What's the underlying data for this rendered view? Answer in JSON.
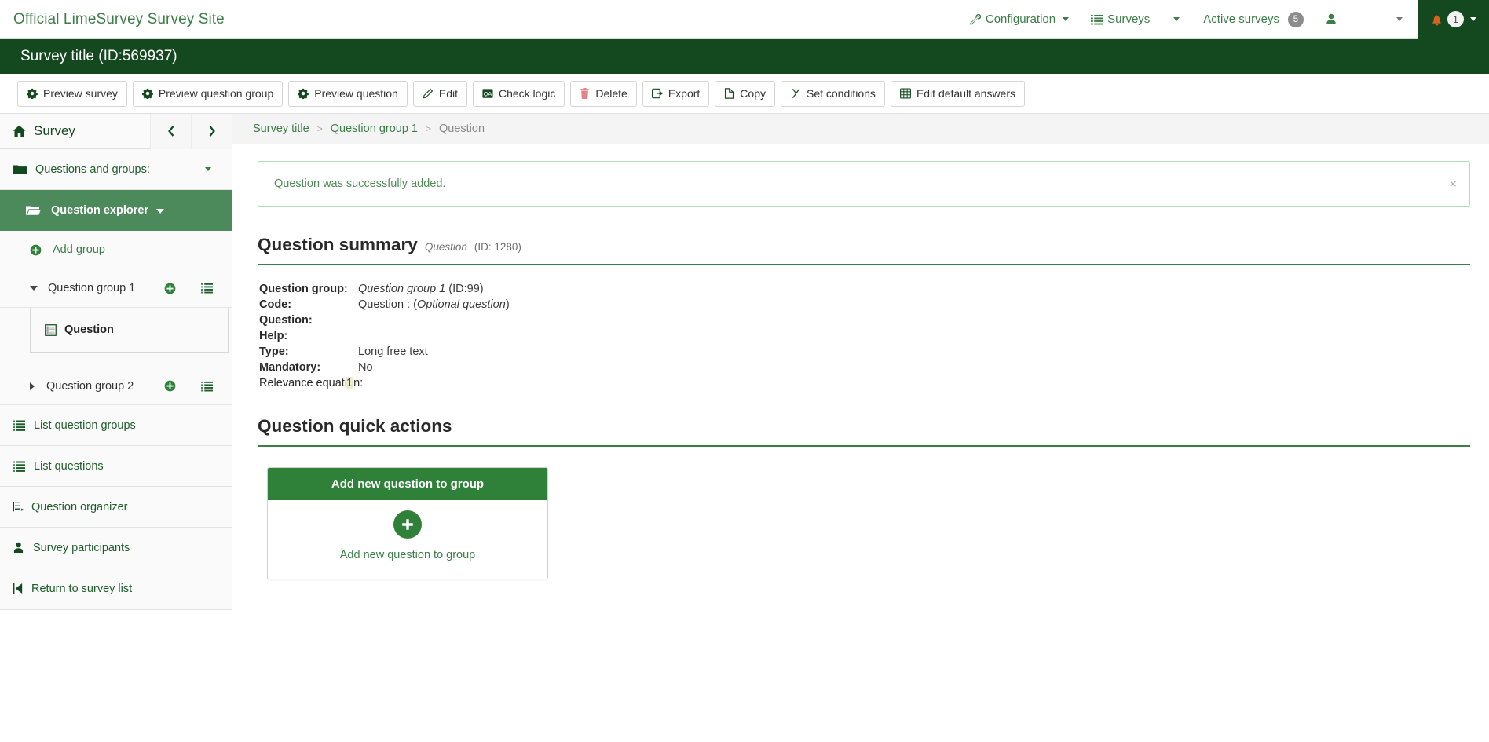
{
  "topbar": {
    "brand": "Official LimeSurvey Survey Site",
    "nav": [
      {
        "label": "Configuration",
        "icon": "wrench-icon",
        "caret": true
      },
      {
        "label": "Surveys",
        "icon": "list-icon",
        "caret": true
      },
      {
        "label": "Active surveys",
        "icon": "",
        "badge": "5"
      }
    ],
    "user_icon": "user-icon",
    "user_caret": true,
    "notifications": {
      "icon": "bell-icon",
      "count": "1"
    }
  },
  "survey_header": {
    "title": "Survey title (ID:569937)"
  },
  "toolbar": {
    "buttons": [
      {
        "label": "Preview survey",
        "icon": "gear-icon"
      },
      {
        "label": "Preview question group",
        "icon": "gear-icon"
      },
      {
        "label": "Preview question",
        "icon": "gear-icon"
      },
      {
        "label": "Edit",
        "icon": "pencil-icon"
      },
      {
        "label": "Check logic",
        "icon": "logic-icon"
      },
      {
        "label": "Delete",
        "icon": "trash-icon"
      },
      {
        "label": "Export",
        "icon": "export-icon"
      },
      {
        "label": "Copy",
        "icon": "copy-icon"
      },
      {
        "label": "Set conditions",
        "icon": "conditions-icon"
      },
      {
        "label": "Edit default answers",
        "icon": "table-icon"
      }
    ]
  },
  "sidebar": {
    "header": {
      "label": "Survey",
      "icon": "home-icon"
    },
    "nav_prev": "chevron-left-icon",
    "nav_next": "chevron-right-icon",
    "questions_and_groups": {
      "label": "Questions and groups:",
      "icon": "folder-icon"
    },
    "question_explorer": {
      "label": "Question explorer",
      "icon": "folder-open-icon"
    },
    "add_group": {
      "label": "Add group",
      "icon": "plus-circle-icon"
    },
    "groups": [
      {
        "label": "Question group 1",
        "expanded": true,
        "questions": [
          {
            "label": "Question",
            "icon": "question-icon"
          }
        ]
      },
      {
        "label": "Question group 2",
        "expanded": false,
        "questions": []
      }
    ],
    "items": [
      {
        "label": "List question groups",
        "icon": "list-icon"
      },
      {
        "label": "List questions",
        "icon": "list-icon"
      },
      {
        "label": "Question organizer",
        "icon": "organizer-icon"
      },
      {
        "label": "Survey participants",
        "icon": "user-icon"
      },
      {
        "label": "Return to survey list",
        "icon": "return-icon"
      }
    ]
  },
  "breadcrumb": {
    "items": [
      {
        "label": "Survey title",
        "current": false
      },
      {
        "label": "Question group 1",
        "current": false
      },
      {
        "label": "Question",
        "current": true
      }
    ],
    "separator": ">"
  },
  "alert": {
    "message": "Question was successfully added.",
    "close": "×"
  },
  "question_summary": {
    "title": "Question summary",
    "sub_italic": "Question",
    "sub_id": "(ID: 1280)",
    "rows": [
      {
        "key": "Question group:",
        "value_italic": "Question group 1",
        "value_plain": " (ID:99)",
        "bold_key": true
      },
      {
        "key": "Code:",
        "value_plain": "Question : (",
        "value_italic": "Optional question",
        "value_tail": ")",
        "bold_key": true
      },
      {
        "key": "Question:",
        "value_plain": "",
        "bold_key": true
      },
      {
        "key": "Help:",
        "value_plain": "",
        "bold_key": true
      },
      {
        "key": "Type:",
        "value_plain": "Long free text",
        "bold_key": true
      },
      {
        "key": "Mandatory:",
        "value_plain": "No",
        "bold_key": true
      },
      {
        "key": "Relevance equation:",
        "value_highlight": "1",
        "bold_key": false
      }
    ]
  },
  "quick_actions": {
    "title": "Question quick actions",
    "card_header": "Add new question to group",
    "card_label": "Add new question to group",
    "card_icon": "plus-circle-icon"
  },
  "colors": {
    "brand_green": "#3c7d48",
    "dark_green": "#14491f",
    "active_green": "#4d8a5b",
    "button_green": "#2f8039",
    "highlight": "#eeeccf"
  }
}
